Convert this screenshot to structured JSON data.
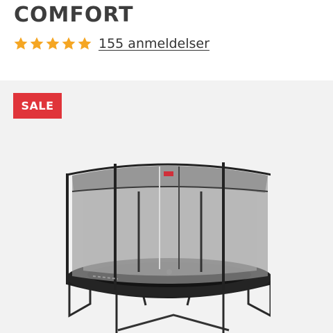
{
  "product": {
    "title": "COMFORT",
    "rating": {
      "stars": 5,
      "max": 5,
      "reviews_label": "155 anmeldelser"
    },
    "badge": "SALE",
    "image_icon": "trampoline-with-safety-net"
  },
  "colors": {
    "star": "#f5a623",
    "badge_bg": "#e0343a",
    "title": "#3d3d3d",
    "image_bg": "#f2f2f2"
  }
}
